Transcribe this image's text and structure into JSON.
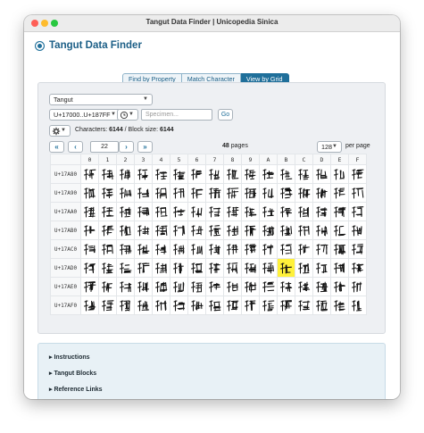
{
  "window": {
    "title": "Tangut Data Finder | Unicopedia Sinica"
  },
  "app": {
    "title": "Tangut Data Finder"
  },
  "tabs": [
    {
      "label": "Find by Property",
      "active": false
    },
    {
      "label": "Match Character",
      "active": false
    },
    {
      "label": "View by Grid",
      "active": true
    }
  ],
  "controls": {
    "script": "Tangut",
    "range": "U+17000..U+187FF",
    "history_icon": "clock-history-icon",
    "specimen_placeholder": "Specimen...",
    "go_label": "Go",
    "settings_icon": "gear-icon",
    "characters_label": "Characters:",
    "characters_count": "6144",
    "block_label": "/ Block size:",
    "block_size": "6144",
    "page_value": "22",
    "pages_count": "48",
    "pages_label": "pages",
    "per_page_value": "128",
    "per_page_label": "per page"
  },
  "grid": {
    "columns": [
      "0",
      "1",
      "2",
      "3",
      "4",
      "5",
      "6",
      "7",
      "8",
      "9",
      "A",
      "B",
      "C",
      "D",
      "E",
      "F"
    ],
    "rows": [
      "U+17A80",
      "U+17A90",
      "U+17AA0",
      "U+17AB0",
      "U+17AC0",
      "U+17AD0",
      "U+17AE0",
      "U+17AF0"
    ],
    "highlight": {
      "row": 5,
      "col": 11
    }
  },
  "footer": {
    "sections": [
      {
        "label": "▸ Instructions"
      },
      {
        "label": "▸ Tangut Blocks"
      },
      {
        "label": "▸ Reference Links"
      }
    ]
  },
  "colors": {
    "accent": "#1f6f9a",
    "highlight": "#fff13a"
  }
}
